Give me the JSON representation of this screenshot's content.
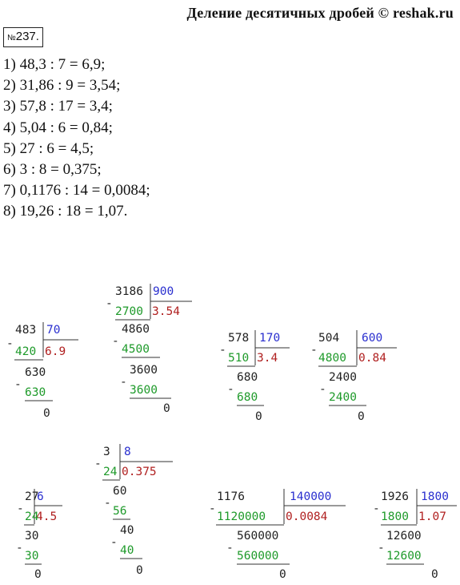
{
  "header": {
    "title": "Деление десятичных дробей © reshak.ru"
  },
  "task": {
    "number_prefix": "№",
    "number": "237."
  },
  "lines": [
    "1) 48,3 : 7 = 6,9;",
    "2) 31,86 : 9 = 3,54;",
    "3) 57,8 : 17 = 3,4;",
    "4) 5,04 : 6 = 0,84;",
    "5) 27 : 6 = 4,5;",
    "6) 3 : 8 = 0,375;",
    "7) 0,1176 : 14 = 0,0084;",
    "8) 19,26 : 18 = 1,07."
  ],
  "minus": "-",
  "c1": {
    "dividend": "483",
    "divisor": "70",
    "quotient": "6.9",
    "r1": "420",
    "s1": "630",
    "r2": "630",
    "rem": "0"
  },
  "c2": {
    "dividend": "3186",
    "divisor": "900",
    "quotient": "3.54",
    "r1": "2700",
    "s1": "4860",
    "r2": "4500",
    "s2": "3600",
    "r3": "3600",
    "rem": "0"
  },
  "c3": {
    "dividend": "578",
    "divisor": "170",
    "quotient": "3.4",
    "r1": "510",
    "s1": "680",
    "r2": "680",
    "rem": "0"
  },
  "c4": {
    "dividend": "504",
    "divisor": "600",
    "quotient": "0.84",
    "r1": "4800",
    "s1": "2400",
    "r2": "2400",
    "rem": "0"
  },
  "c5": {
    "dividend": "27",
    "divisor": "6",
    "quotient": "4.5",
    "r1": "24",
    "s1": "30",
    "r2": "30",
    "rem": "0"
  },
  "c6": {
    "dividend": "3",
    "divisor": "8",
    "quotient": "0.375",
    "r1": "24",
    "s1": "60",
    "r2": "56",
    "s2": "40",
    "r3": "40",
    "rem": "0"
  },
  "c7": {
    "dividend": "1176",
    "divisor": "140000",
    "quotient": "0.0084",
    "r1": "1120000",
    "s1": "560000",
    "r2": "560000",
    "rem": "0"
  },
  "c8": {
    "dividend": "1926",
    "divisor": "1800",
    "quotient": "1.07",
    "r1": "1800",
    "s1": "12600",
    "r2": "12600",
    "rem": "0"
  }
}
